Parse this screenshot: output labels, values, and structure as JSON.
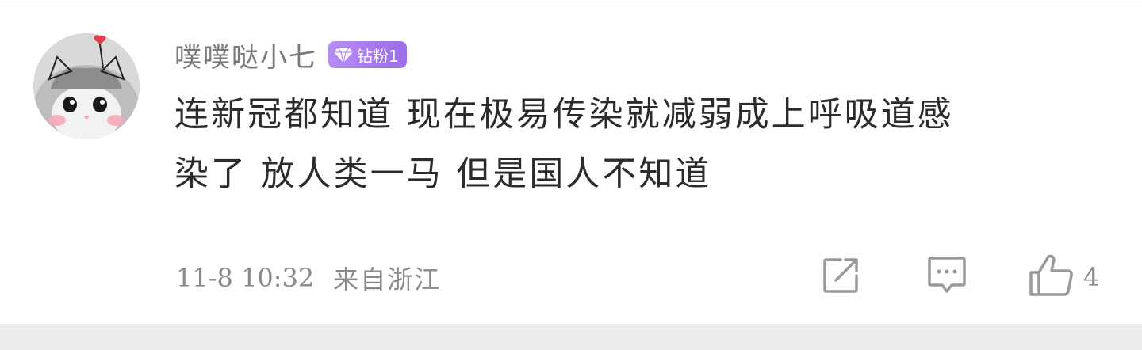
{
  "comment": {
    "author": {
      "name": "噗噗哒小七",
      "badge": "钻粉1",
      "avatar_icon": "cat-avatar"
    },
    "lines": [
      "连新冠都知道 现在极易传染就减弱成上呼吸道感",
      "染了 放人类一马 但是国人不知道"
    ],
    "date": "11-8 10:32",
    "location": "来自浙江",
    "actions": {
      "share_icon": "share-icon",
      "comment_icon": "comment-icon",
      "like_icon": "thumbs-up-icon",
      "like_count": "4"
    }
  },
  "colors": {
    "badge_gradient_start": "#b88cf5",
    "badge_gradient_end": "#9a6ee8",
    "text_primary": "#2b2b2b",
    "text_secondary": "#8a8a8a",
    "icon_gray": "#9a9a9a",
    "bottom_band": "#ededed"
  }
}
